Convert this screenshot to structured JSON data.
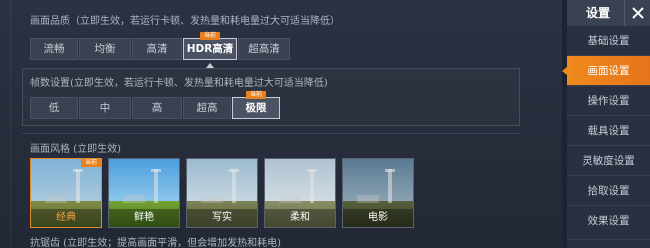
{
  "graphics_quality": {
    "label": "画面品质（立即生效，若运行卡顿、发热量和耗电量过大可适当降低）",
    "options": [
      "流畅",
      "均衡",
      "高清",
      "HDR高清",
      "超高清"
    ],
    "selected_index": 3,
    "badge": "当前"
  },
  "frame_rate": {
    "label": "帧数设置(立即生效，若运行卡顿、发热量和耗电量过大可适当降低)",
    "options": [
      "低",
      "中",
      "高",
      "超高",
      "极限"
    ],
    "selected_index": 4,
    "badge": "当前"
  },
  "graphics_style": {
    "label": "画面风格 (立即生效)",
    "badge": "当前",
    "selected_index": 0,
    "styles": [
      {
        "name": "经典",
        "sky": "#6aa0c8",
        "ground": "#6b7a3a"
      },
      {
        "name": "鲜艳",
        "sky": "#4e9fd9",
        "ground": "#5f8a2e"
      },
      {
        "name": "写实",
        "sky": "#8fb0c4",
        "ground": "#6c7446"
      },
      {
        "name": "柔和",
        "sky": "#9fb6c6",
        "ground": "#7b8058"
      },
      {
        "name": "电影",
        "sky": "#5d7f96",
        "ground": "#4d5735"
      }
    ]
  },
  "anti_aliasing": {
    "label": "抗锯齿 (立即生效；提高画面平滑，但会增加发热和耗电)"
  },
  "sidebar": {
    "title": "设置",
    "close_icon": "close-icon",
    "items": [
      {
        "label": "基础设置"
      },
      {
        "label": "画面设置"
      },
      {
        "label": "操作设置"
      },
      {
        "label": "载具设置"
      },
      {
        "label": "灵敏度设置"
      },
      {
        "label": "拾取设置"
      },
      {
        "label": "效果设置"
      }
    ],
    "active_index": 1
  },
  "colors": {
    "accent": "#f08a1c",
    "background": "#262c3a",
    "selected_border": "#c7ccd6"
  }
}
